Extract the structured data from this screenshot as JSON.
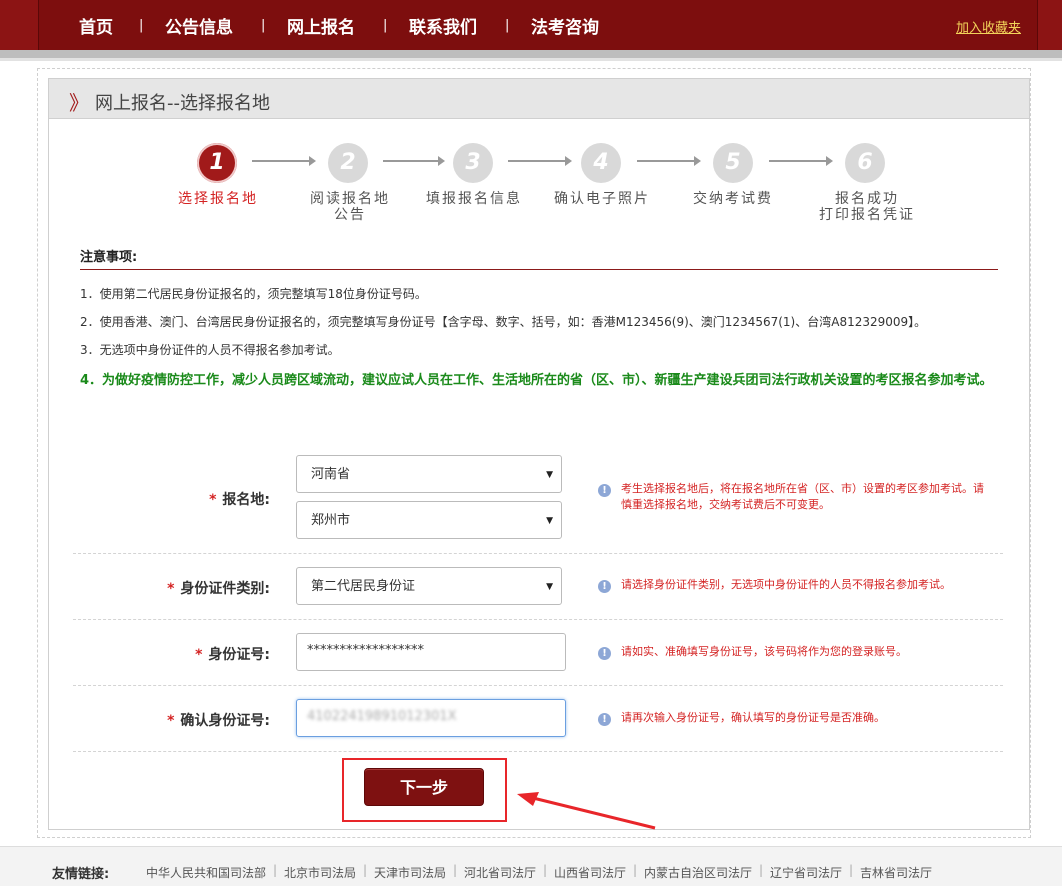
{
  "nav": {
    "items": [
      "首页",
      "公告信息",
      "网上报名",
      "联系我们",
      "法考咨询"
    ],
    "separator": "|",
    "favorite": "加入收藏夹"
  },
  "panel": {
    "chevron": "》",
    "title": "网上报名--选择报名地"
  },
  "steps": [
    {
      "num": "1",
      "label": "选择报名地",
      "label2": ""
    },
    {
      "num": "2",
      "label": "阅读报名地",
      "label2": "公告"
    },
    {
      "num": "3",
      "label": "填报报名信息",
      "label2": ""
    },
    {
      "num": "4",
      "label": "确认电子照片",
      "label2": ""
    },
    {
      "num": "5",
      "label": "交纳考试费",
      "label2": ""
    },
    {
      "num": "6",
      "label": "报名成功",
      "label2": "打印报名凭证"
    }
  ],
  "notice": {
    "title": "注意事项:",
    "line1": "1．使用第二代居民身份证报名的，须完整填写18位身份证号码。",
    "line2": "2．使用香港、澳门、台湾居民身份证报名的，须完整填写身份证号【含字母、数字、括号，如：香港M123456(9)、澳门1234567(1)、台湾A812329009】。",
    "line3": "3．无选项中身份证件的人员不得报名参加考试。",
    "line4": "4．为做好疫情防控工作，减少人员跨区域流动，建议应试人员在工作、生活地所在的省（区、市）、新疆生产建设兵团司法行政机关设置的考区报名参加考试。"
  },
  "form": {
    "star": "*",
    "location_label": "报名地:",
    "province": "河南省",
    "city": "郑州市",
    "location_hint": "考生选择报名地后，将在报名地所在省（区、市）设置的考区参加考试。请慎重选择报名地，交纳考试费后不可变更。",
    "idtype_label": "身份证件类别:",
    "idtype": "第二代居民身份证",
    "idtype_hint": "请选择身份证件类别，无选项中身份证件的人员不得报名参加考试。",
    "idnum_label": "身份证号:",
    "idnum": "******************",
    "idnum_hint": "请如实、准确填写身份证号，该号码将作为您的登录账号。",
    "confirm_label": "确认身份证号:",
    "confirm_value": "41022419891012301X",
    "confirm_hint": "请再次输入身份证号，确认填写的身份证号是否准确。",
    "hint_icon": "!",
    "caret": "▼",
    "next": "下一步"
  },
  "footer": {
    "label": "友情链接:",
    "links": [
      "中华人民共和国司法部",
      "北京市司法局",
      "天津市司法局",
      "河北省司法厅",
      "山西省司法厅",
      "内蒙古自治区司法厅",
      "辽宁省司法厅",
      "吉林省司法厅"
    ],
    "separator": "|"
  },
  "colors": {
    "brand": "#7d0e0e",
    "accent_red": "#d42323",
    "notice_green": "#1a8a1a",
    "step_inactive": "#d9d9d9"
  }
}
